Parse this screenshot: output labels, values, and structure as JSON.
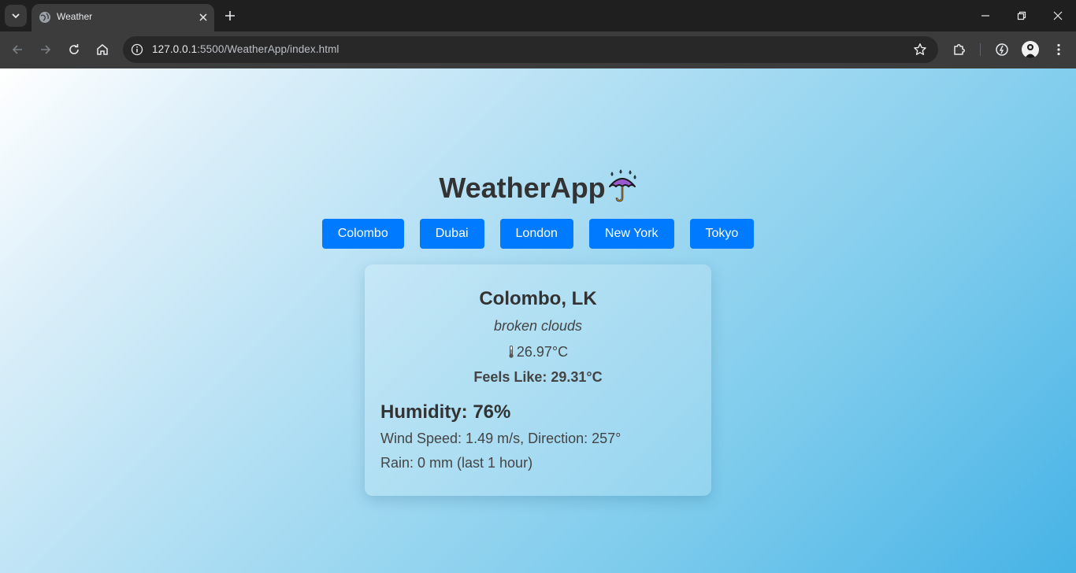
{
  "browser": {
    "tab_title": "Weather",
    "url_host": "127.0.0.1",
    "url_rest": ":5500/WeatherApp/index.html"
  },
  "app": {
    "title": "WeatherApp"
  },
  "cities": [
    "Colombo",
    "Dubai",
    "London",
    "New York",
    "Tokyo"
  ],
  "weather": {
    "location": "Colombo, LK",
    "description": "broken clouds",
    "temperature": "26.97°C",
    "feels_like": "Feels Like: 29.31°C",
    "humidity": "Humidity: 76%",
    "wind": "Wind Speed: 1.49 m/s, Direction: 257°",
    "rain": "Rain: 0 mm (last 1 hour)"
  },
  "colors": {
    "button": "#007bff",
    "text": "#333333"
  }
}
